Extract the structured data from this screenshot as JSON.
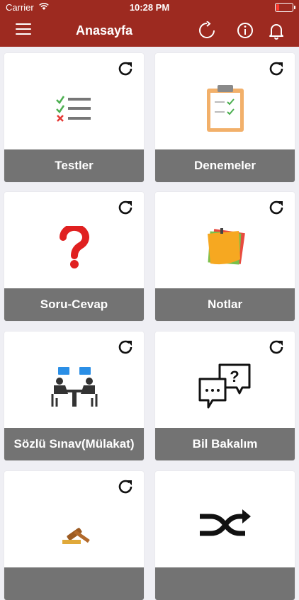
{
  "status_bar": {
    "carrier": "Carrier",
    "time": "10:28 PM"
  },
  "header": {
    "title": "Anasayfa",
    "menu_icon": "hamburger-menu-icon",
    "refresh_icon": "refresh-icon",
    "info_icon": "info-icon",
    "notification_icon": "bell-icon"
  },
  "cards": [
    {
      "label": "Testler",
      "icon": "checklist-icon"
    },
    {
      "label": "Denemeler",
      "icon": "clipboard-icon"
    },
    {
      "label": "Soru-Cevap",
      "icon": "question-mark-icon"
    },
    {
      "label": "Notlar",
      "icon": "sticky-notes-icon"
    },
    {
      "label": "Sözlü Sınav(Mülakat)",
      "icon": "interview-icon"
    },
    {
      "label": "Bil Bakalım",
      "icon": "speech-bubbles-icon"
    },
    {
      "label": "",
      "icon": "gavel-icon"
    },
    {
      "label": "",
      "icon": "shuffle-icon"
    }
  ],
  "colors": {
    "header": "#9d2a20",
    "label_bar": "#737373",
    "background": "#efeff4"
  }
}
